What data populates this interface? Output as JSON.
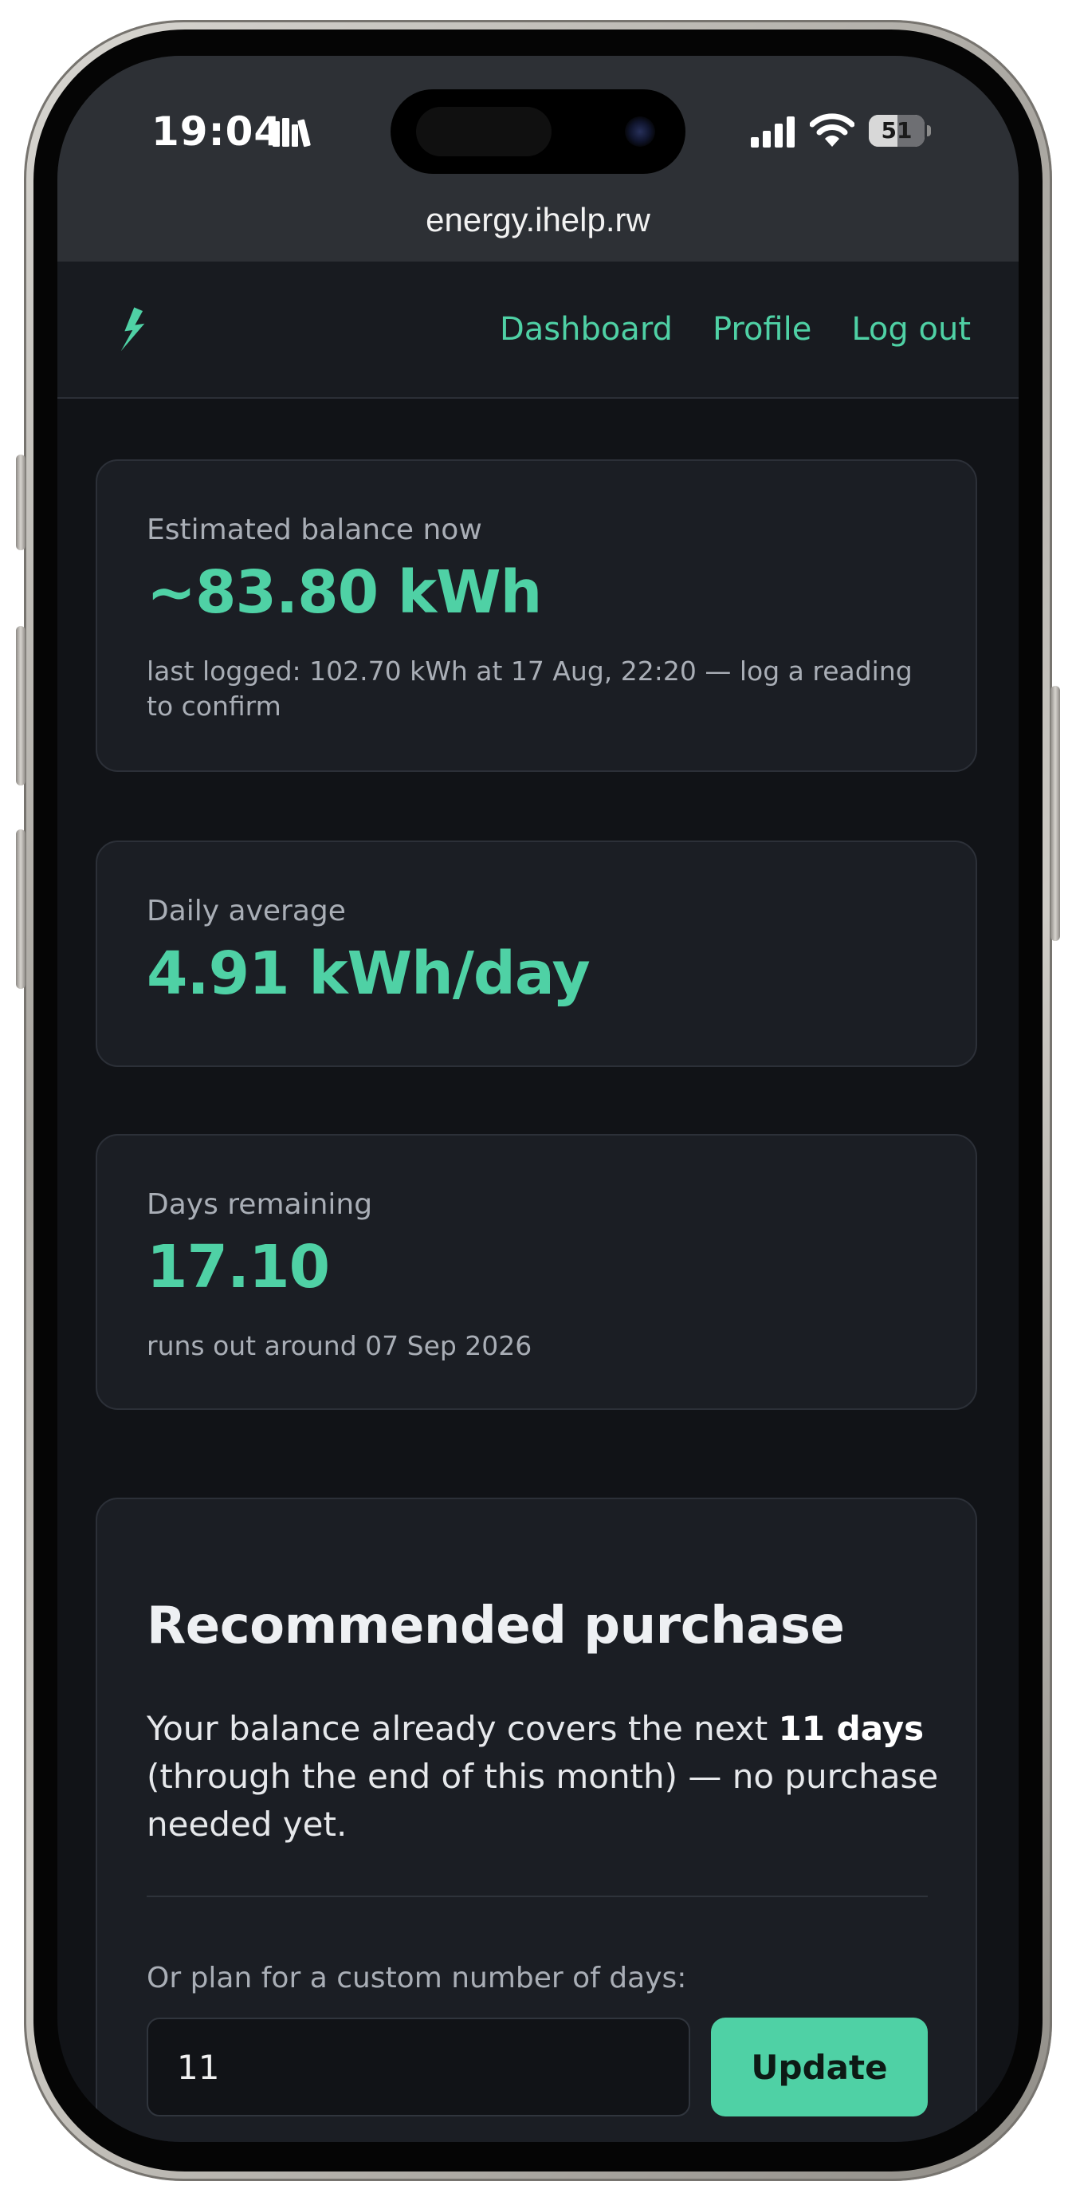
{
  "status_bar": {
    "time": "19:04",
    "battery_percent": "51",
    "battery_level": 0.51
  },
  "browser": {
    "url": "energy.ihelp.rw"
  },
  "nav": {
    "links": [
      "Dashboard",
      "Profile",
      "Log out"
    ]
  },
  "balance_card": {
    "label": "Estimated balance now",
    "value": "~83.80 kWh",
    "note": "last logged: 102.70 kWh at 17 Aug, 22:20 — log a reading to confirm"
  },
  "average_card": {
    "label": "Daily average",
    "value": "4.91 kWh/day"
  },
  "days_card": {
    "label": "Days remaining",
    "value": "17.10",
    "note": "runs out around 07 Sep 2026"
  },
  "recommendation": {
    "title": "Recommended purchase",
    "text_before": "Your balance already covers the next ",
    "text_bold": "11 days",
    "text_after": " (through the end of this month) — no purchase needed yet.",
    "custom_label": "Or plan for a custom number of days:",
    "custom_days_value": "11",
    "update_label": "Update"
  },
  "colors": {
    "accent": "#4fd1a5",
    "background": "#111317",
    "card": "#1b1e24",
    "chrome": "#2d3035"
  }
}
